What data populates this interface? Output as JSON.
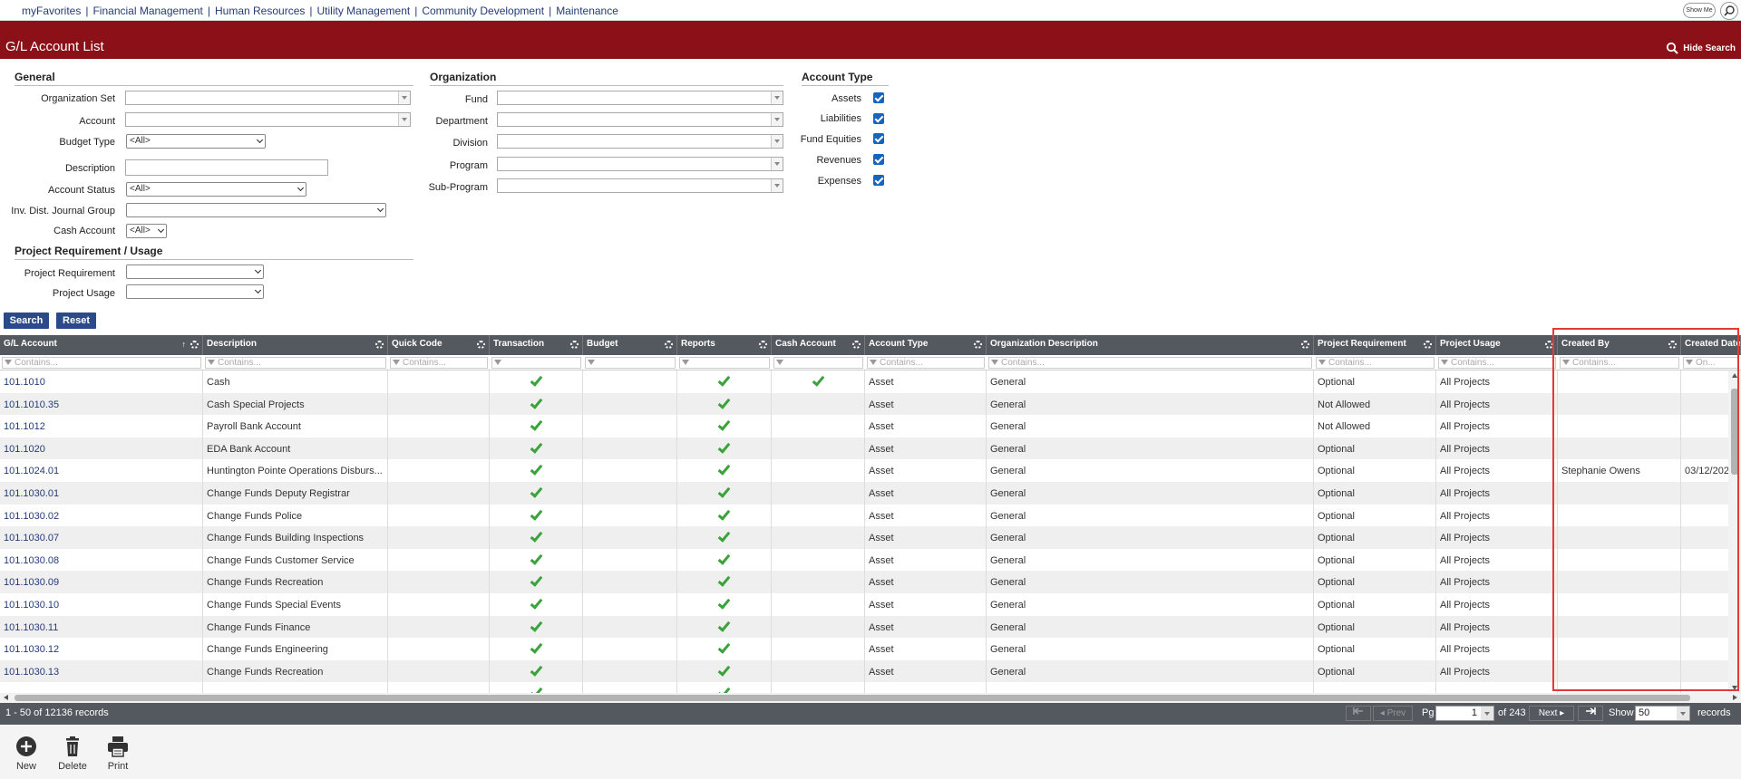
{
  "nav": {
    "links": [
      "myFavorites",
      "Financial Management",
      "Human Resources",
      "Utility Management",
      "Community Development",
      "Maintenance"
    ],
    "show_me": "Show Me"
  },
  "title": "G/L Account List",
  "hide_search": "Hide Search",
  "sections": {
    "general": "General",
    "organization": "Organization",
    "account_type": "Account Type",
    "project": "Project Requirement / Usage"
  },
  "general": {
    "organization_set": "Organization Set",
    "account": "Account",
    "budget_type": "Budget Type",
    "budget_type_value": "<All>",
    "description": "Description",
    "account_status": "Account Status",
    "account_status_value": "<All>",
    "inv_dist": "Inv. Dist. Journal Group",
    "cash_account": "Cash Account",
    "cash_account_value": "<All>"
  },
  "organization": {
    "fund": "Fund",
    "department": "Department",
    "division": "Division",
    "program": "Program",
    "sub_program": "Sub-Program"
  },
  "account_type": {
    "assets": "Assets",
    "liabilities": "Liabilities",
    "fund_equities": "Fund Equities",
    "revenues": "Revenues",
    "expenses": "Expenses"
  },
  "project": {
    "requirement": "Project Requirement",
    "usage": "Project Usage"
  },
  "buttons": {
    "search": "Search",
    "reset": "Reset"
  },
  "grid": {
    "columns": [
      "G/L Account",
      "Description",
      "Quick Code",
      "Transaction",
      "Budget",
      "Reports",
      "Cash Account",
      "Account Type",
      "Organization Description",
      "Project Requirement",
      "Project Usage",
      "Created By",
      "Created Date"
    ],
    "filter_placeholders": [
      "Contains...",
      "Contains...",
      "Contains...",
      "",
      "",
      "",
      "",
      "Contains...",
      "Contains...",
      "Contains...",
      "Contains...",
      "Contains...",
      "On..."
    ],
    "rows": [
      {
        "account": "101.1010",
        "description": "Cash",
        "transaction": true,
        "reports": true,
        "cash": true,
        "type": "Asset",
        "org": "General",
        "req": "Optional",
        "usage": "All Projects",
        "created_by": "",
        "created_date": ""
      },
      {
        "account": "101.1010.35",
        "description": "Cash Special Projects",
        "transaction": true,
        "reports": true,
        "cash": false,
        "type": "Asset",
        "org": "General",
        "req": "Not Allowed",
        "usage": "All Projects",
        "created_by": "",
        "created_date": ""
      },
      {
        "account": "101.1012",
        "description": "Payroll Bank Account",
        "transaction": true,
        "reports": true,
        "cash": false,
        "type": "Asset",
        "org": "General",
        "req": "Not Allowed",
        "usage": "All Projects",
        "created_by": "",
        "created_date": ""
      },
      {
        "account": "101.1020",
        "description": "EDA Bank Account",
        "transaction": true,
        "reports": true,
        "cash": false,
        "type": "Asset",
        "org": "General",
        "req": "Optional",
        "usage": "All Projects",
        "created_by": "",
        "created_date": ""
      },
      {
        "account": "101.1024.01",
        "description": "Huntington Pointe Operations Disburs...",
        "transaction": true,
        "reports": true,
        "cash": false,
        "type": "Asset",
        "org": "General",
        "req": "Optional",
        "usage": "All Projects",
        "created_by": "Stephanie Owens",
        "created_date": "03/12/202"
      },
      {
        "account": "101.1030.01",
        "description": "Change Funds Deputy Registrar",
        "transaction": true,
        "reports": true,
        "cash": false,
        "type": "Asset",
        "org": "General",
        "req": "Optional",
        "usage": "All Projects",
        "created_by": "",
        "created_date": ""
      },
      {
        "account": "101.1030.02",
        "description": "Change Funds Police",
        "transaction": true,
        "reports": true,
        "cash": false,
        "type": "Asset",
        "org": "General",
        "req": "Optional",
        "usage": "All Projects",
        "created_by": "",
        "created_date": ""
      },
      {
        "account": "101.1030.07",
        "description": "Change Funds Building Inspections",
        "transaction": true,
        "reports": true,
        "cash": false,
        "type": "Asset",
        "org": "General",
        "req": "Optional",
        "usage": "All Projects",
        "created_by": "",
        "created_date": ""
      },
      {
        "account": "101.1030.08",
        "description": "Change Funds Customer Service",
        "transaction": true,
        "reports": true,
        "cash": false,
        "type": "Asset",
        "org": "General",
        "req": "Optional",
        "usage": "All Projects",
        "created_by": "",
        "created_date": ""
      },
      {
        "account": "101.1030.09",
        "description": "Change Funds Recreation",
        "transaction": true,
        "reports": true,
        "cash": false,
        "type": "Asset",
        "org": "General",
        "req": "Optional",
        "usage": "All Projects",
        "created_by": "",
        "created_date": ""
      },
      {
        "account": "101.1030.10",
        "description": "Change Funds Special Events",
        "transaction": true,
        "reports": true,
        "cash": false,
        "type": "Asset",
        "org": "General",
        "req": "Optional",
        "usage": "All Projects",
        "created_by": "",
        "created_date": ""
      },
      {
        "account": "101.1030.11",
        "description": "Change Funds Finance",
        "transaction": true,
        "reports": true,
        "cash": false,
        "type": "Asset",
        "org": "General",
        "req": "Optional",
        "usage": "All Projects",
        "created_by": "",
        "created_date": ""
      },
      {
        "account": "101.1030.12",
        "description": "Change Funds Engineering",
        "transaction": true,
        "reports": true,
        "cash": false,
        "type": "Asset",
        "org": "General",
        "req": "Optional",
        "usage": "All Projects",
        "created_by": "",
        "created_date": ""
      },
      {
        "account": "101.1030.13",
        "description": "Change Funds Recreation",
        "transaction": true,
        "reports": true,
        "cash": false,
        "type": "Asset",
        "org": "General",
        "req": "Optional",
        "usage": "All Projects",
        "created_by": "",
        "created_date": ""
      },
      {
        "account": "",
        "description": "",
        "transaction": true,
        "reports": true,
        "cash": false,
        "type": "",
        "org": "",
        "req": "",
        "usage": "",
        "created_by": "",
        "created_date": ""
      }
    ]
  },
  "pager": {
    "records": "1 - 50 of 12136 records",
    "prev": "Prev",
    "pg_label": "Pg",
    "page": "1",
    "of": "of 243",
    "next": "Next",
    "show": "Show",
    "page_size": "50",
    "records_label": "records"
  },
  "toolbar": {
    "new": "New",
    "delete": "Delete",
    "print": "Print"
  },
  "colors": {
    "brand": "#8c1018",
    "header": "#53595e",
    "link": "#243b78",
    "check": "#3aa33a",
    "highlight": "#e53935"
  }
}
